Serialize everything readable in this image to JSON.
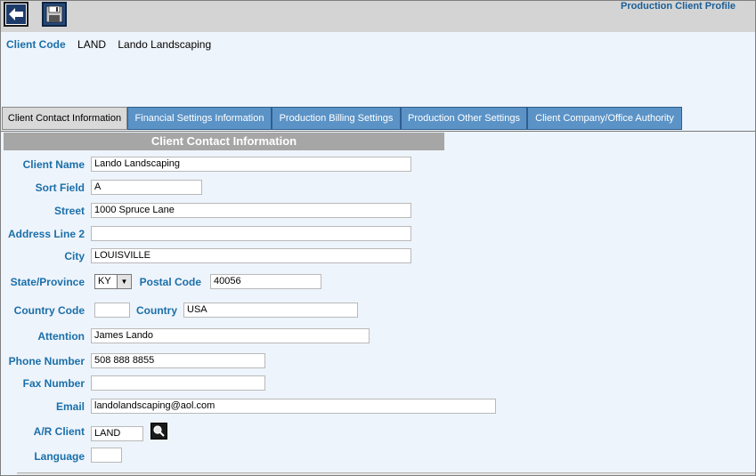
{
  "window": {
    "title": "Production Client Profile"
  },
  "toolbar": {
    "back_label": "",
    "save_label": ""
  },
  "client": {
    "code_label": "Client Code",
    "code": "LAND",
    "name": "Lando Landscaping"
  },
  "tabs": [
    {
      "label": "Client Contact Information",
      "active": true
    },
    {
      "label": "Financial Settings Information",
      "active": false
    },
    {
      "label": "Production Billing Settings",
      "active": false
    },
    {
      "label": "Production Other Settings",
      "active": false
    },
    {
      "label": "Client Company/Office Authority",
      "active": false
    }
  ],
  "section": {
    "title": "Client Contact Information"
  },
  "fields": {
    "client_name": {
      "label": "Client Name",
      "value": "Lando Landscaping"
    },
    "sort_field": {
      "label": "Sort Field",
      "value": "A"
    },
    "street": {
      "label": "Street",
      "value": "1000 Spruce Lane"
    },
    "address_line_2": {
      "label": "Address Line 2",
      "value": ""
    },
    "city": {
      "label": "City",
      "value": "LOUISVILLE"
    },
    "state": {
      "label": "State/Province",
      "value": "KY"
    },
    "postal_code": {
      "label": "Postal Code",
      "value": "40056"
    },
    "country_code": {
      "label": "Country Code",
      "value": ""
    },
    "country": {
      "label": "Country",
      "value": "USA"
    },
    "attention": {
      "label": "Attention",
      "value": "James Lando"
    },
    "phone": {
      "label": "Phone Number",
      "value": "508 888 8855"
    },
    "fax": {
      "label": "Fax Number",
      "value": ""
    },
    "email": {
      "label": "Email",
      "value": "landolandscaping@aol.com"
    },
    "ar_client": {
      "label": "A/R Client",
      "value": "LAND"
    },
    "language": {
      "label": "Language",
      "value": ""
    }
  }
}
